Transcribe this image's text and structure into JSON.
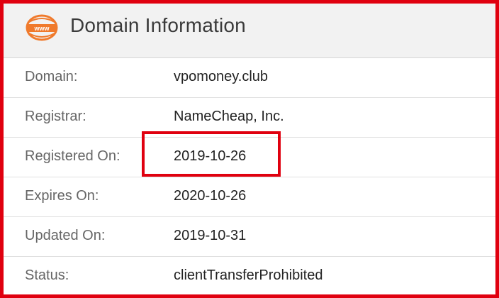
{
  "header": {
    "title": "Domain Information",
    "icon": "www-icon"
  },
  "rows": [
    {
      "label": "Domain:",
      "value": "vpomoney.club"
    },
    {
      "label": "Registrar:",
      "value": "NameCheap, Inc."
    },
    {
      "label": "Registered On:",
      "value": "2019-10-26"
    },
    {
      "label": "Expires On:",
      "value": "2020-10-26"
    },
    {
      "label": "Updated On:",
      "value": "2019-10-31"
    },
    {
      "label": "Status:",
      "value": "clientTransferProhibited"
    }
  ],
  "colors": {
    "highlight": "#e0000f",
    "icon": "#f07a2c",
    "header_bg": "#f2f2f2"
  },
  "highlighted_row": "Registered On:"
}
